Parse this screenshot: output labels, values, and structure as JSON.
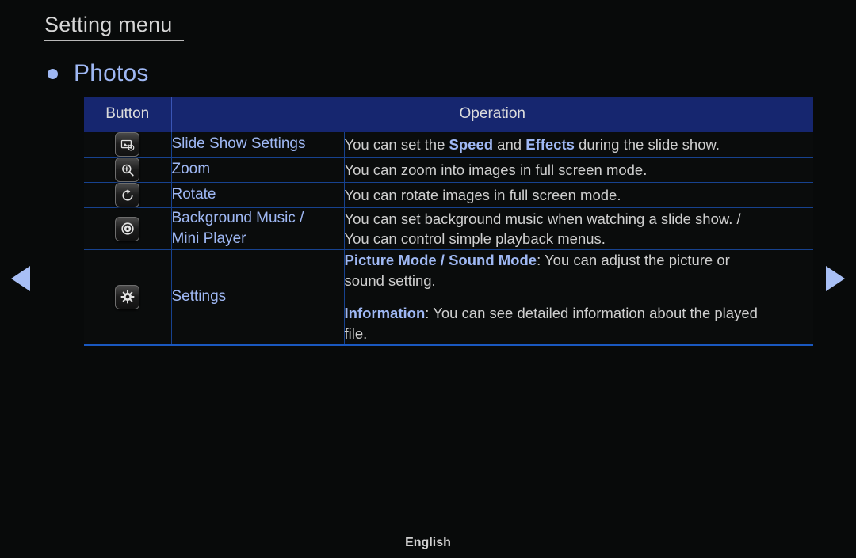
{
  "page": {
    "title": "Setting menu",
    "section_bullet_icon": "bullet-dot-icon",
    "section_label": "Photos",
    "background_color": "#0a0c0c",
    "accent_color": "#9fb8f4",
    "header_color": "#16266f",
    "border_color": "#17428f"
  },
  "table": {
    "headers": {
      "button": "Button",
      "operation": "Operation"
    },
    "rows": [
      {
        "icon": "slide-show-settings-icon",
        "name": "Slide Show Settings",
        "description": {
          "paragraphs": [
            {
              "lines": [
                {
                  "segments": [
                    {
                      "text": "You can set the ",
                      "highlight": false
                    },
                    {
                      "text": "Speed",
                      "highlight": true
                    },
                    {
                      "text": " and ",
                      "highlight": false
                    },
                    {
                      "text": "Effects",
                      "highlight": true
                    },
                    {
                      "text": " during the slide show.",
                      "highlight": false
                    }
                  ]
                }
              ]
            }
          ]
        }
      },
      {
        "icon": "zoom-magnifier-icon",
        "name": "Zoom",
        "description": {
          "paragraphs": [
            {
              "lines": [
                {
                  "segments": [
                    {
                      "text": "You can zoom into images in full screen mode.",
                      "highlight": false
                    }
                  ]
                }
              ]
            }
          ]
        }
      },
      {
        "icon": "rotate-icon",
        "name": "Rotate",
        "description": {
          "paragraphs": [
            {
              "lines": [
                {
                  "segments": [
                    {
                      "text": "You can rotate images in full screen mode.",
                      "highlight": false
                    }
                  ]
                }
              ]
            }
          ]
        }
      },
      {
        "icon": "background-music-disc-icon",
        "name": "Background Music /\nMini Player",
        "name_lines": [
          "Background Music /",
          "Mini Player"
        ],
        "description": {
          "paragraphs": [
            {
              "lines": [
                {
                  "segments": [
                    {
                      "text": "You can set background music when watching a slide show. /",
                      "highlight": false
                    }
                  ]
                },
                {
                  "segments": [
                    {
                      "text": "You can control simple playback menus.",
                      "highlight": false
                    }
                  ]
                }
              ]
            }
          ]
        }
      },
      {
        "icon": "settings-gear-icon",
        "name": "Settings",
        "description": {
          "paragraphs": [
            {
              "lines": [
                {
                  "segments": [
                    {
                      "text": "Picture Mode / Sound Mode",
                      "highlight": true
                    },
                    {
                      "text": ": You can adjust the picture or",
                      "highlight": false
                    }
                  ]
                },
                {
                  "segments": [
                    {
                      "text": "sound setting.",
                      "highlight": false
                    }
                  ]
                }
              ]
            },
            {
              "lines": [
                {
                  "segments": [
                    {
                      "text": "Information",
                      "highlight": true
                    },
                    {
                      "text": ": You can see detailed information about the played",
                      "highlight": false
                    }
                  ]
                },
                {
                  "segments": [
                    {
                      "text": "file.",
                      "highlight": false
                    }
                  ]
                }
              ]
            }
          ]
        }
      }
    ]
  },
  "navigation": {
    "prev_icon": "triangle-left-icon",
    "next_icon": "triangle-right-icon"
  },
  "footer": {
    "language": "English"
  }
}
